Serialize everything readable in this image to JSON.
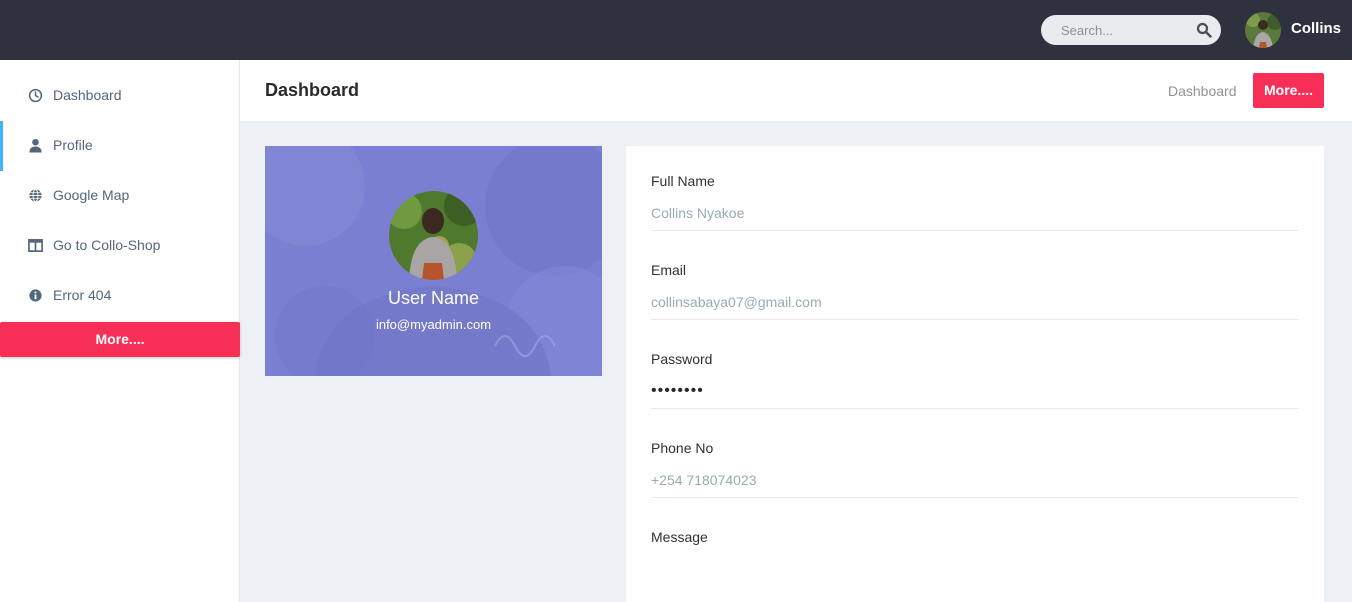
{
  "topbar": {
    "search_placeholder": "Search...",
    "user_name": "Collins"
  },
  "sidebar": {
    "items": [
      {
        "label": "Dashboard",
        "icon": "clock-icon"
      },
      {
        "label": "Profile",
        "icon": "user-icon",
        "active": true
      },
      {
        "label": "Google Map",
        "icon": "globe-icon"
      },
      {
        "label": "Go to Collo-Shop",
        "icon": "columns-icon"
      },
      {
        "label": "Error 404",
        "icon": "info-circle-icon"
      }
    ],
    "more_label": "More...."
  },
  "header": {
    "title": "Dashboard",
    "breadcrumb": "Dashboard",
    "more_label": "More...."
  },
  "profile": {
    "name": "User Name",
    "email": "info@myadmin.com"
  },
  "form": {
    "full_name": {
      "label": "Full Name",
      "value": "Collins Nyakoe"
    },
    "email": {
      "label": "Email",
      "value": "collinsabaya07@gmail.com"
    },
    "password": {
      "label": "Password",
      "value": "password"
    },
    "phone": {
      "label": "Phone No",
      "value": "+254 718074023"
    },
    "message": {
      "label": "Message"
    }
  },
  "colors": {
    "topbar": "#2f323e",
    "accent": "#f72f56",
    "active_indicator": "#41b3f9",
    "profile_overlay": "#7b7fd1"
  }
}
